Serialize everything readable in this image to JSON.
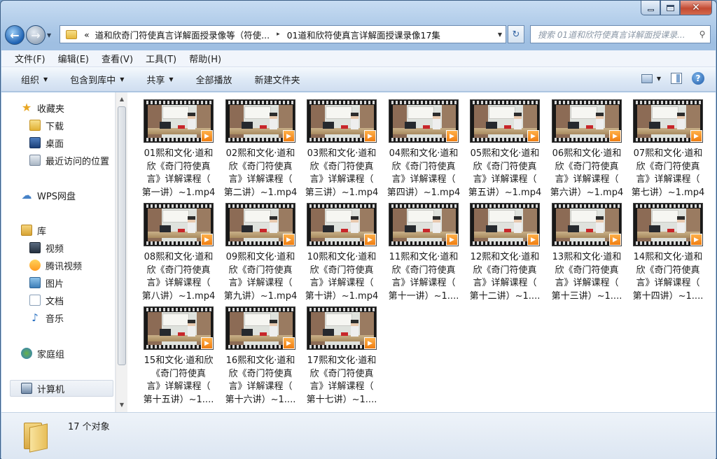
{
  "window": {
    "min_icon": "minimize-icon",
    "max_icon": "maximize-icon",
    "close_icon": "close-icon"
  },
  "address": {
    "chevrons": "«",
    "crumb1": "道和欣奇门符使真言详解面授录像等（符使...",
    "arrow": "▸",
    "crumb2": "01道和欣符使真言详解面授课录像17集",
    "search_placeholder": "搜索 01道和欣符使真言详解面授课录..."
  },
  "menu": [
    "文件(F)",
    "编辑(E)",
    "查看(V)",
    "工具(T)",
    "帮助(H)"
  ],
  "toolbar": {
    "organize": "组织",
    "include_library": "包含到库中",
    "share": "共享",
    "play_all": "全部播放",
    "new_folder": "新建文件夹"
  },
  "nav": {
    "favorites": "收藏夹",
    "downloads": "下载",
    "desktop": "桌面",
    "recent": "最近访问的位置",
    "wps": "WPS网盘",
    "libraries": "库",
    "videos": "视频",
    "tencent_video": "腾讯视频",
    "pictures": "图片",
    "documents": "文档",
    "music": "音乐",
    "homegroup": "家庭组",
    "computer": "计算机"
  },
  "files": [
    {
      "lines": [
        "01熙和文化·道和",
        "欣《奇门符使真",
        "言》详解课程（",
        "第一讲）~1.mp4"
      ]
    },
    {
      "lines": [
        "02熙和文化·道和",
        "欣《奇门符使真",
        "言》详解课程（",
        "第二讲）~1.mp4"
      ]
    },
    {
      "lines": [
        "03熙和文化·道和",
        "欣《奇门符使真",
        "言》详解课程（",
        "第三讲）~1.mp4"
      ]
    },
    {
      "lines": [
        "04熙和文化·道和",
        "欣《奇门符使真",
        "言》详解课程（",
        "第四讲）~1.mp4"
      ]
    },
    {
      "lines": [
        "05熙和文化·道和",
        "欣《奇门符使真",
        "言》详解课程（",
        "第五讲）~1.mp4"
      ]
    },
    {
      "lines": [
        "06熙和文化·道和",
        "欣《奇门符使真",
        "言》详解课程（",
        "第六讲）~1.mp4"
      ]
    },
    {
      "lines": [
        "07熙和文化·道和",
        "欣《奇门符使真",
        "言》详解课程（",
        "第七讲）~1.mp4"
      ]
    },
    {
      "lines": [
        "08熙和文化·道和",
        "欣《奇门符使真",
        "言》详解课程（",
        "第八讲）~1.mp4"
      ]
    },
    {
      "lines": [
        "09熙和文化·道和",
        "欣《奇门符使真",
        "言》详解课程（",
        "第九讲）~1.mp4"
      ]
    },
    {
      "lines": [
        "10熙和文化·道和",
        "欣《奇门符使真",
        "言》详解课程（",
        "第十讲）~1.mp4"
      ]
    },
    {
      "lines": [
        "11熙和文化·道和",
        "欣《奇门符使真",
        "言》详解课程（",
        "第十一讲）~1...."
      ]
    },
    {
      "lines": [
        "12熙和文化·道和",
        "欣《奇门符使真",
        "言》详解课程（",
        "第十二讲）~1...."
      ]
    },
    {
      "lines": [
        "13熙和文化·道和",
        "欣《奇门符使真",
        "言》详解课程（",
        "第十三讲）~1...."
      ]
    },
    {
      "lines": [
        "14熙和文化·道和",
        "欣《奇门符使真",
        "言》详解课程（",
        "第十四讲）~1...."
      ]
    },
    {
      "lines": [
        "15和文化·道和欣",
        "《奇门符使真",
        "言》详解课程（",
        "第十五讲）~1...."
      ]
    },
    {
      "lines": [
        "16熙和文化·道和",
        "欣《奇门符使真",
        "言》详解课程（",
        "第十六讲）~1...."
      ]
    },
    {
      "lines": [
        "17熙和文化·道和",
        "欣《奇门符使真",
        "言》详解课程（",
        "第十七讲）~1...."
      ]
    }
  ],
  "status": {
    "count": "17 个对象"
  }
}
